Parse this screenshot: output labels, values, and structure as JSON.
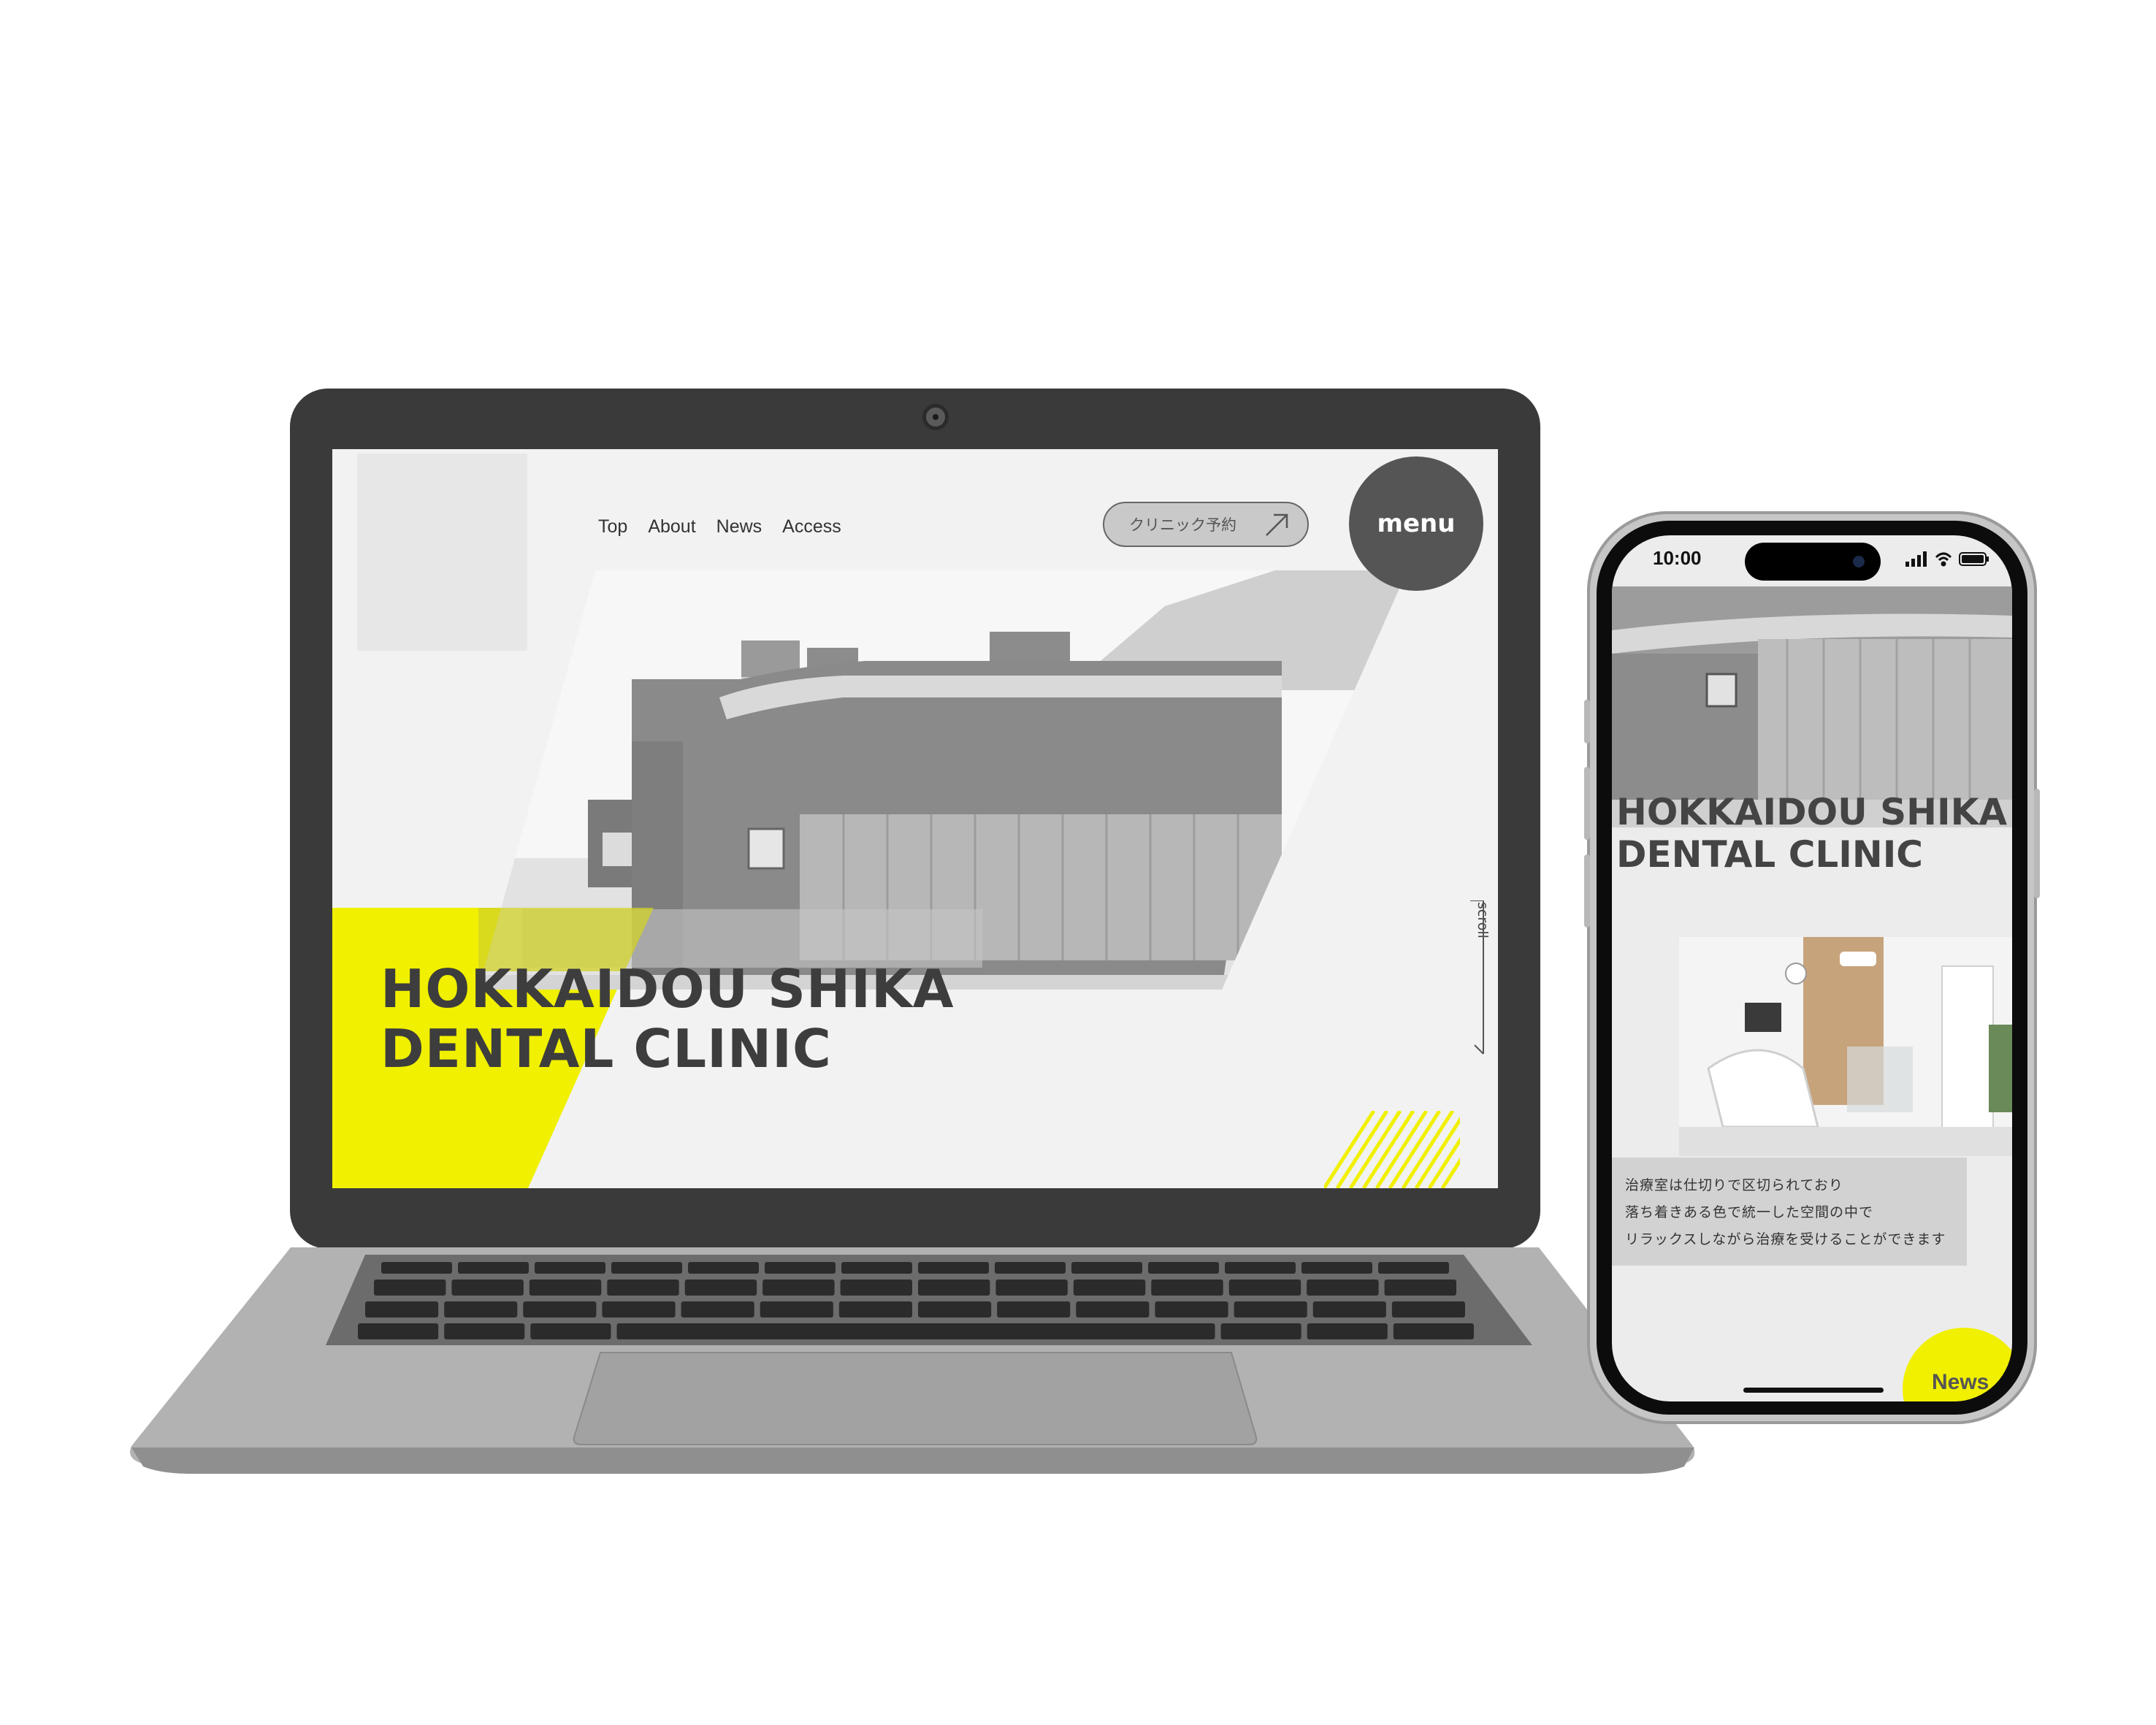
{
  "colors": {
    "accent_yellow": "#f0f000",
    "dark_gray": "#3a3a3a",
    "screen_bg": "#f2f2f2",
    "menu_circle": "#555555"
  },
  "laptop": {
    "nav": [
      {
        "label": "Top"
      },
      {
        "label": "About"
      },
      {
        "label": "News"
      },
      {
        "label": "Access"
      }
    ],
    "reserve_button": {
      "label": "クリニック予約",
      "icon": "arrow-up-right-icon"
    },
    "menu_button": {
      "label": "menu"
    },
    "hero_title": {
      "line1": "HOKKAIDOU SHIKA",
      "line2": "DENTAL CLINIC"
    },
    "scroll_label": "scroll"
  },
  "phone": {
    "status_time": "10:00",
    "status_icons": [
      "signal-icon",
      "wifi-icon",
      "battery-icon"
    ],
    "hero_title": {
      "line1": "HOKKAIDOU SHIKA",
      "line2": "DENTAL CLINIC"
    },
    "caption": [
      "治療室は仕切りで区切られており",
      "落ち着きある色で統一した空間の中で",
      "リラックスしながら治療を受けることができます"
    ],
    "news_button": {
      "label": "News"
    }
  }
}
